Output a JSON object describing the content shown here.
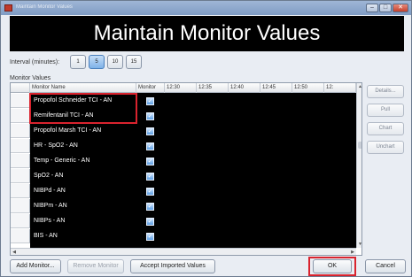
{
  "window": {
    "title": "Maintain Monitor Values",
    "min": "–",
    "max": "□",
    "close": "✕"
  },
  "header": {
    "title": "Maintain Monitor Values"
  },
  "interval": {
    "label": "Interval (minutes):",
    "options": [
      "1",
      "5",
      "10",
      "15"
    ],
    "selected": "5"
  },
  "monitor_values": {
    "label": "Monitor Values",
    "columns": [
      "Monitor Name",
      "Monitor",
      "12:30",
      "12:35",
      "12:40",
      "12:45",
      "12:50",
      "12:"
    ],
    "rows": [
      {
        "name": "Propofol Schneider TCI - AN",
        "monitor": true
      },
      {
        "name": "Remifentanil TCI - AN",
        "monitor": true
      },
      {
        "name": "Propofol Marsh TCI - AN",
        "monitor": true
      },
      {
        "name": "HR - SpO2 - AN",
        "monitor": true
      },
      {
        "name": "Temp - Generic - AN",
        "monitor": true
      },
      {
        "name": "SpO2 - AN",
        "monitor": true
      },
      {
        "name": "NIBPd - AN",
        "monitor": true
      },
      {
        "name": "NIBPm - AN",
        "monitor": true
      },
      {
        "name": "NIBPs - AN",
        "monitor": true
      },
      {
        "name": "BIS - AN",
        "monitor": true
      }
    ]
  },
  "side_buttons": {
    "details": "Details...",
    "pull": "Pull",
    "chart": "Chart",
    "unchart": "Unchart"
  },
  "bottom_buttons": {
    "add_monitor": "Add Monitor...",
    "remove_monitor": "Remove Monitor",
    "accept_imported": "Accept Imported Values",
    "ok": "OK",
    "cancel": "Cancel"
  },
  "colors": {
    "highlight": "#d9232e",
    "grid_background": "#000000",
    "selected_interval": "#7fb2e8"
  }
}
